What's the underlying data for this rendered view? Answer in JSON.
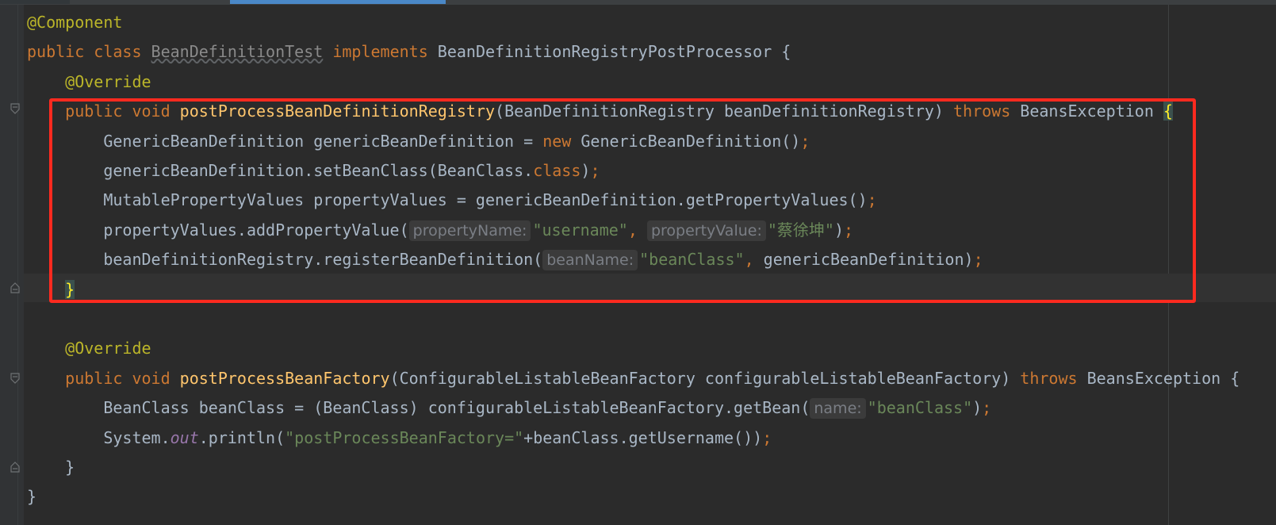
{
  "editor": {
    "lines": [
      {
        "indent": "",
        "parts": [
          {
            "t": "@Component",
            "c": "ann"
          }
        ]
      },
      {
        "indent": "",
        "parts": [
          {
            "t": "public class ",
            "c": "kw"
          },
          {
            "t": "BeanDefinitionTest",
            "c": "squig"
          },
          {
            "t": " implements ",
            "c": "kw"
          },
          {
            "t": "BeanDefinitionRegistryPostProcessor {",
            "c": ""
          }
        ]
      },
      {
        "indent": "    ",
        "parts": [
          {
            "t": "@Override",
            "c": "ann"
          }
        ]
      },
      {
        "indent": "    ",
        "parts": [
          {
            "t": "public void ",
            "c": "kw"
          },
          {
            "t": "postProcessBeanDefinitionRegistry",
            "c": "fn"
          },
          {
            "t": "(BeanDefinitionRegistry beanDefinitionRegistry) ",
            "c": ""
          },
          {
            "t": "throws ",
            "c": "kw"
          },
          {
            "t": "BeansException ",
            "c": ""
          },
          {
            "t": "{",
            "c": "brace-hl"
          }
        ]
      },
      {
        "indent": "        ",
        "parts": [
          {
            "t": "GenericBeanDefinition genericBeanDefinition = ",
            "c": ""
          },
          {
            "t": "new ",
            "c": "kw"
          },
          {
            "t": "GenericBeanDefinition()",
            "c": ""
          },
          {
            "t": ";",
            "c": "kw"
          }
        ]
      },
      {
        "indent": "        ",
        "parts": [
          {
            "t": "genericBeanDefinition.setBeanClass(BeanClass.",
            "c": ""
          },
          {
            "t": "class",
            "c": "kw"
          },
          {
            "t": ")",
            "c": ""
          },
          {
            "t": ";",
            "c": "kw"
          }
        ]
      },
      {
        "indent": "        ",
        "parts": [
          {
            "t": "MutablePropertyValues propertyValues = genericBeanDefinition.getPropertyValues()",
            "c": ""
          },
          {
            "t": ";",
            "c": "kw"
          }
        ]
      },
      {
        "indent": "        ",
        "parts": [
          {
            "t": "propertyValues.addPropertyValue(",
            "c": ""
          },
          {
            "t": "propertyName:",
            "c": "hint"
          },
          {
            "t": "\"username\"",
            "c": "str"
          },
          {
            "t": ", ",
            "c": "kw"
          },
          {
            "t": "propertyValue:",
            "c": "hint"
          },
          {
            "t": "\"蔡徐坤\"",
            "c": "str"
          },
          {
            "t": ")",
            "c": ""
          },
          {
            "t": ";",
            "c": "kw"
          }
        ]
      },
      {
        "indent": "        ",
        "parts": [
          {
            "t": "beanDefinitionRegistry.registerBeanDefinition(",
            "c": ""
          },
          {
            "t": "beanName:",
            "c": "hint"
          },
          {
            "t": "\"beanClass\"",
            "c": "str"
          },
          {
            "t": ", ",
            "c": "kw"
          },
          {
            "t": "genericBeanDefinition)",
            "c": ""
          },
          {
            "t": ";",
            "c": "kw"
          }
        ]
      },
      {
        "indent": "    ",
        "parts": [
          {
            "t": "}",
            "c": "brace-hl"
          }
        ]
      },
      {
        "indent": "",
        "parts": []
      },
      {
        "indent": "    ",
        "parts": [
          {
            "t": "@Override",
            "c": "ann"
          }
        ]
      },
      {
        "indent": "    ",
        "parts": [
          {
            "t": "public void ",
            "c": "kw"
          },
          {
            "t": "postProcessBeanFactory",
            "c": "fn"
          },
          {
            "t": "(ConfigurableListableBeanFactory configurableListableBeanFactory) ",
            "c": ""
          },
          {
            "t": "throws ",
            "c": "kw"
          },
          {
            "t": "BeansException {",
            "c": ""
          }
        ]
      },
      {
        "indent": "        ",
        "parts": [
          {
            "t": "BeanClass beanClass = (BeanClass) configurableListableBeanFactory.getBean(",
            "c": ""
          },
          {
            "t": "name:",
            "c": "hint"
          },
          {
            "t": "\"beanClass\"",
            "c": "str"
          },
          {
            "t": ")",
            "c": ""
          },
          {
            "t": ";",
            "c": "kw"
          }
        ]
      },
      {
        "indent": "        ",
        "parts": [
          {
            "t": "System.",
            "c": ""
          },
          {
            "t": "out",
            "c": "ital"
          },
          {
            "t": ".println(",
            "c": ""
          },
          {
            "t": "\"postProcessBeanFactory=\"",
            "c": "str"
          },
          {
            "t": "+beanClass.getUsername())",
            "c": ""
          },
          {
            "t": ";",
            "c": "kw"
          }
        ]
      },
      {
        "indent": "    ",
        "parts": [
          {
            "t": "}",
            "c": ""
          }
        ]
      },
      {
        "indent": "",
        "parts": [
          {
            "t": "}",
            "c": ""
          }
        ]
      }
    ]
  },
  "colors": {
    "background": "#2b2b2b",
    "keyword": "#cc7832",
    "annotation": "#bbb529",
    "method": "#ffc66d",
    "string": "#6a8759",
    "highlight_box": "#ff2a1f"
  }
}
